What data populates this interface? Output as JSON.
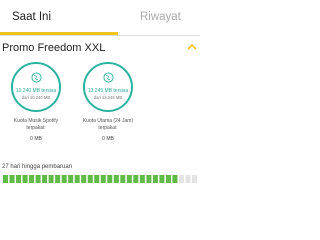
{
  "tabs": {
    "active": "Saat Ini",
    "inactive": "Riwayat"
  },
  "package": {
    "title": "Promo Freedom XXL"
  },
  "quotas": [
    {
      "remaining": "10.240 MB tersisa",
      "total": "dari 10.240 MB",
      "label": "Kuota Musik Spotify terpakai:",
      "used": "0 MB"
    },
    {
      "remaining": "13.245 MB tersisa",
      "total": "dari 13.245 MB",
      "label": "Kuota Utama (24 Jam) terpakai:",
      "used": "0 MB"
    }
  ],
  "renewal": {
    "text": "27 hari hingga pembaruan",
    "days_remaining": 27,
    "segments_total": 30
  },
  "colors": {
    "accent": "#f3c21b",
    "teal": "#2bb3a0",
    "green": "#5fba46",
    "empty": "#e3e3e3"
  }
}
